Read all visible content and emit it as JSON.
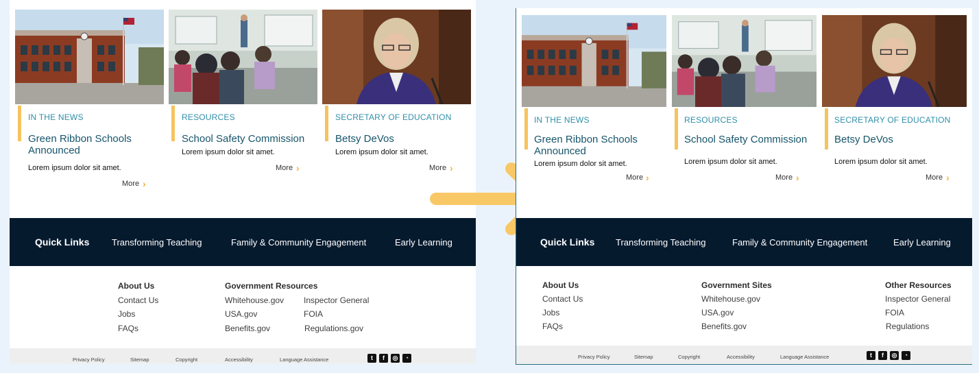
{
  "before": {
    "cards": [
      {
        "kicker": "IN THE NEWS",
        "title": "Green Ribbon Schools Announced",
        "desc": "Lorem ipsum dolor sit amet.",
        "more": "More"
      },
      {
        "kicker": "RESOURCES",
        "title": "School Safety Commission",
        "desc": "Lorem ipsum dolor sit amet.",
        "more": "More"
      },
      {
        "kicker": "SECRETARY OF EDUCATION",
        "title": "Betsy DeVos",
        "desc": "Lorem ipsum dolor sit amet.",
        "more": "More"
      }
    ],
    "quicklinks": {
      "heading": "Quick Links",
      "items": [
        "Transforming Teaching",
        "Family & Community Engagement",
        "Early Learning"
      ]
    },
    "footer": {
      "about_heading": "About Us",
      "about_links": [
        "Contact Us",
        "Jobs",
        "FAQs"
      ],
      "gov_heading": "Government Resources",
      "gov_links": [
        "Whitehouse.gov",
        "USA.gov",
        "Benefits.gov"
      ],
      "gov_links_2": [
        "Inspector General",
        "FOIA",
        "Regulations.gov"
      ]
    },
    "legal": [
      "Privacy Policy",
      "Sitemap",
      "Copyright",
      "Accessibility",
      "Language Assistance"
    ]
  },
  "after": {
    "cards": [
      {
        "kicker": "IN THE NEWS",
        "title": "Green Ribbon Schools Announced",
        "desc": "Lorem ipsum dolor sit amet.",
        "more": "More"
      },
      {
        "kicker": "RESOURCES",
        "title": "School Safety Commission",
        "desc": "Lorem ipsum dolor sit amet.",
        "more": "More"
      },
      {
        "kicker": "SECRETARY OF EDUCATION",
        "title": "Betsy DeVos",
        "desc": "Lorem ipsum dolor sit amet.",
        "more": "More"
      }
    ],
    "quicklinks": {
      "heading": "Quick Links",
      "items": [
        "Transforming Teaching",
        "Family & Community Engagement",
        "Early Learning"
      ]
    },
    "footer": {
      "about_heading": "About Us",
      "about_links": [
        "Contact Us",
        "Jobs",
        "FAQs"
      ],
      "gov_heading": "Government Sites",
      "gov_links": [
        "Whitehouse.gov",
        "USA.gov",
        "Benefits.gov"
      ],
      "other_heading": "Other Resources",
      "other_links": [
        "Inspector General",
        "FOIA",
        "Regulations"
      ]
    },
    "legal": [
      "Privacy Policy",
      "Sitemap",
      "Copyright",
      "Accessibility",
      "Language Assistance"
    ]
  },
  "social_icons": [
    "twitter-icon",
    "facebook-icon",
    "instagram-icon",
    "rss-icon"
  ],
  "colors": {
    "accent": "#f5c35e",
    "kicker": "#2f8fa9",
    "title": "#17556b",
    "quicklinks_bg": "#061a2e",
    "arrow": "#f8c867"
  }
}
